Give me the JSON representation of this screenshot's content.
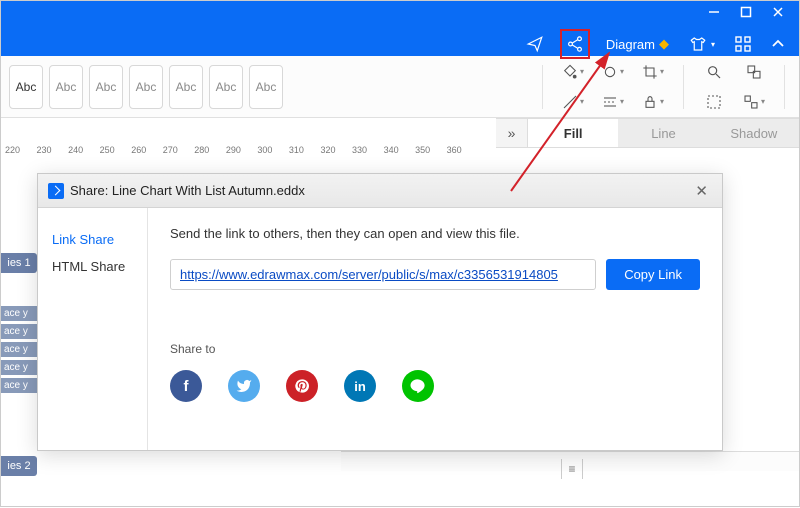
{
  "window": {
    "title_label": ""
  },
  "topmenu": {
    "diagram_label": "Diagram"
  },
  "toolbar": {
    "textbox_labels": [
      "Abc",
      "Abc",
      "Abc",
      "Abc",
      "Abc",
      "Abc",
      "Abc"
    ]
  },
  "panel_tabs": {
    "fill": "Fill",
    "line": "Line",
    "shadow": "Shadow"
  },
  "ruler": {
    "ticks": [
      "220",
      "230",
      "240",
      "250",
      "260",
      "270",
      "280",
      "290",
      "300",
      "310",
      "320",
      "330",
      "340",
      "350",
      "360"
    ]
  },
  "left_items": {
    "series1": "ies 1",
    "series2": "ies 2",
    "ace_items": [
      "ace y",
      "ace y",
      "ace y",
      "ace y",
      "ace y"
    ]
  },
  "share_dialog": {
    "title": "Share: Line Chart With List Autumn.eddx",
    "tabs": {
      "link": "Link Share",
      "html": "HTML Share"
    },
    "instruction": "Send the link to others, then they can open and view this file.",
    "url": "https://www.edrawmax.com/server/public/s/max/c3356531914805",
    "copy_label": "Copy Link",
    "share_to_label": "Share to",
    "social": {
      "facebook": "f",
      "twitter": "t",
      "pinterest": "p",
      "linkedin": "in",
      "line": "L"
    }
  }
}
